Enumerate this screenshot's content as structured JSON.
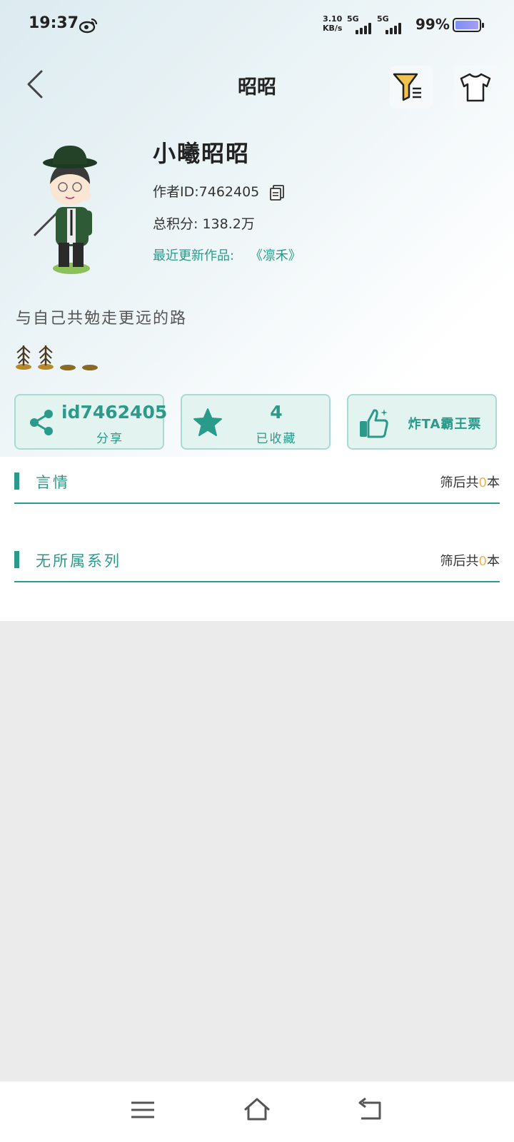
{
  "status_bar": {
    "time": "19:37",
    "network_speed": "3.10",
    "network_unit": "KB/s",
    "sim1": "5G",
    "sim2": "5G",
    "battery_percent": "99%"
  },
  "header": {
    "title": "昭昭"
  },
  "profile": {
    "name": "小曦昭昭",
    "author_id_label": "作者ID:",
    "author_id": "7462405",
    "score_label": "总积分:",
    "score": "138.2万",
    "latest_label": "最近更新作品:",
    "latest_work": "《凛禾》",
    "motto": "与自己共勉走更远的路"
  },
  "cards": {
    "share_value": "id7462405",
    "share_label": "分享",
    "fav_value": "4",
    "fav_label": "已收藏",
    "vote_label": "炸TA霸王票"
  },
  "sections": [
    {
      "title": "言情",
      "count_prefix": "筛后共",
      "count": "0",
      "count_suffix": "本"
    },
    {
      "title": "无所属系列",
      "count_prefix": "筛后共",
      "count": "0",
      "count_suffix": "本"
    }
  ],
  "colors": {
    "accent": "#2a9a8a",
    "count_highlight": "#f2b24a"
  }
}
